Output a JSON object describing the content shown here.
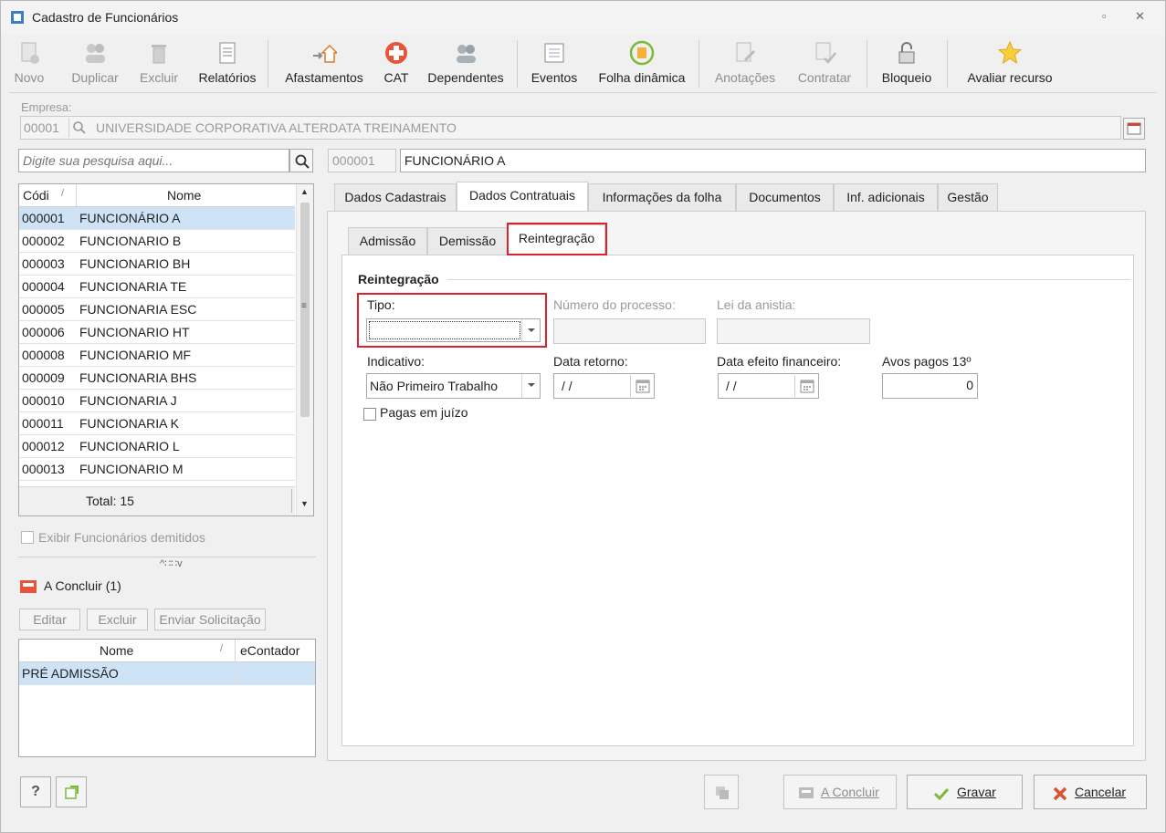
{
  "window": {
    "title": "Cadastro de Funcionários"
  },
  "toolbar": {
    "items": [
      {
        "label": "Novo",
        "icon": "new-doc-icon",
        "enabled": false
      },
      {
        "label": "Duplicar",
        "icon": "users-icon",
        "enabled": false
      },
      {
        "label": "Excluir",
        "icon": "trash-icon",
        "enabled": false
      },
      {
        "label": "Relatórios",
        "icon": "report-icon",
        "enabled": true
      },
      {
        "label": "Afastamentos",
        "icon": "house-arrow-icon",
        "enabled": true
      },
      {
        "label": "CAT",
        "icon": "medical-cross-icon",
        "enabled": true
      },
      {
        "label": "Dependentes",
        "icon": "people-icon",
        "enabled": true
      },
      {
        "label": "Eventos",
        "icon": "list-icon",
        "enabled": true
      },
      {
        "label": "Folha dinâmica",
        "icon": "calculator-refresh-icon",
        "enabled": true
      },
      {
        "label": "Anotações",
        "icon": "notes-icon",
        "enabled": false
      },
      {
        "label": "Contratar",
        "icon": "contract-check-icon",
        "enabled": false
      },
      {
        "label": "Bloqueio",
        "icon": "padlock-icon",
        "enabled": true
      },
      {
        "label": "Avaliar recurso",
        "icon": "star-icon",
        "enabled": true
      }
    ]
  },
  "empresa": {
    "label": "Empresa:",
    "code": "00001",
    "name": "UNIVERSIDADE CORPORATIVA ALTERDATA TREINAMENTO"
  },
  "search": {
    "placeholder": "Digite sua pesquisa aqui..."
  },
  "employee": {
    "code": "000001",
    "name": "FUNCIONÁRIO A"
  },
  "list": {
    "col_code": "Códi",
    "col_name": "Nome",
    "rows": [
      {
        "code": "000001",
        "name": "FUNCIONÁRIO A"
      },
      {
        "code": "000002",
        "name": "FUNCIONARIO B"
      },
      {
        "code": "000003",
        "name": "FUNCIONARIO BH"
      },
      {
        "code": "000004",
        "name": "FUNCIONARIA TE"
      },
      {
        "code": "000005",
        "name": "FUNCIONARIA ESC"
      },
      {
        "code": "000006",
        "name": "FUNCIONARIO HT"
      },
      {
        "code": "000008",
        "name": "FUNCIONARIO MF"
      },
      {
        "code": "000009",
        "name": "FUNCIONARIA BHS"
      },
      {
        "code": "000010",
        "name": "FUNCIONARIA J"
      },
      {
        "code": "000011",
        "name": "FUNCIONARIA K"
      },
      {
        "code": "000012",
        "name": "FUNCIONARIO L"
      },
      {
        "code": "000013",
        "name": "FUNCIONARIO M"
      }
    ],
    "total": "Total: 15"
  },
  "show_dismissed": "Exibir Funcionários demitidos",
  "pending": {
    "title": "A Concluir (1)",
    "buttons": {
      "edit": "Editar",
      "delete": "Excluir",
      "send": "Enviar Solicitação"
    },
    "col_name": "Nome",
    "col_econtador": "eContador",
    "rows": [
      {
        "name": "PRÉ ADMISSÃO",
        "econtador": ""
      }
    ]
  },
  "tabs": [
    "Dados Cadastrais",
    "Dados Contratuais",
    "Informações da folha",
    "Documentos",
    "Inf. adicionais",
    "Gestão"
  ],
  "subtabs": [
    "Admissão",
    "Demissão",
    "Reintegração"
  ],
  "reintegracao": {
    "section": "Reintegração",
    "tipo_label": "Tipo:",
    "tipo_value": "",
    "processo_label": "Número do processo:",
    "anistia_label": "Lei da anistia:",
    "indicativo_label": "Indicativo:",
    "indicativo_value": "Não Primeiro Trabalho",
    "data_retorno_label": "Data retorno:",
    "data_retorno_value": "/ /",
    "data_efeito_label": "Data efeito financeiro:",
    "data_efeito_value": "/ /",
    "avos_label": "Avos pagos 13º",
    "avos_value": "0",
    "pagas_label": "Pagas em juízo"
  },
  "footer": {
    "a_concluir": "A Concluir",
    "gravar": "Gravar",
    "cancelar": "Cancelar"
  },
  "colors": {
    "selection": "#cfe3f6",
    "highlight": "#d9232e"
  }
}
